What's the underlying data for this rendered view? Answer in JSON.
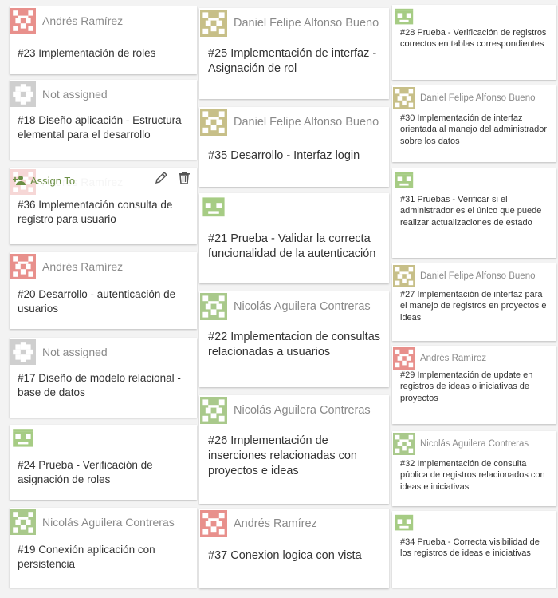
{
  "board": {
    "columns": [
      {
        "cards": [
          {
            "owner": "Andrés Ramírez",
            "avatar": "red",
            "title": "#23 Implementación de roles"
          },
          {
            "owner": "Not assigned",
            "avatar": "gray",
            "title": "#18 Diseño aplicación - Estructura elemental para el desarrollo"
          },
          {
            "owner": "Andrés Ramírez",
            "avatar": "red",
            "title": "#36 Implementación consulta de registro para usuario",
            "hovered": true
          },
          {
            "owner": "Andrés Ramírez",
            "avatar": "red",
            "title": "#20 Desarrollo - autenticación de usuarios"
          },
          {
            "owner": "Not assigned",
            "avatar": "gray",
            "title": "#17 Diseño de modelo relacional - base de datos"
          },
          {
            "owner": "",
            "avatar": "green2",
            "title": "#24 Prueba - Verificación de asignación de roles"
          },
          {
            "owner": "Nicolás Aguilera Contreras",
            "avatar": "green",
            "title": "#19 Conexión aplicación con persistencia"
          }
        ]
      },
      {
        "cards": [
          {
            "owner": "Daniel Felipe Alfonso Bueno",
            "avatar": "olive",
            "title": "#25 Implementación de interfaz - Asignación de rol"
          },
          {
            "owner": "Daniel Felipe Alfonso Bueno",
            "avatar": "olive",
            "title": "#35 Desarrollo - Interfaz login"
          },
          {
            "owner": "",
            "avatar": "green2",
            "title": "#21 Prueba - Validar la correcta funcionalidad de la autenticación"
          },
          {
            "owner": "Nicolás Aguilera Contreras",
            "avatar": "green",
            "title": "#22 Implementacion de consultas relacionadas a usuarios"
          },
          {
            "owner": "Nicolás Aguilera Contreras",
            "avatar": "green",
            "title": "#26 Implementación de inserciones relacionadas con proyectos e ideas"
          },
          {
            "owner": "Andrés Ramírez",
            "avatar": "red",
            "title": "#37 Conexion logica con vista"
          }
        ]
      },
      {
        "cards": [
          {
            "owner": "",
            "avatar": "green2",
            "title": "#28 Prueba - Verificación de registros correctos en tablas correspondientes"
          },
          {
            "owner": "Daniel Felipe Alfonso Bueno",
            "avatar": "olive",
            "title": "#30 Implementación de interfaz orientada al manejo del administrador sobre los datos"
          },
          {
            "owner": "",
            "avatar": "green2",
            "title": "#31 Pruebas - Verificar si el administrador es el único que puede realizar actualizaciones de estado"
          },
          {
            "owner": "Daniel Felipe Alfonso Bueno",
            "avatar": "olive",
            "title": "#27 Implementación de interfaz para el manejo de registros en proyectos e ideas"
          },
          {
            "owner": "Andrés Ramírez",
            "avatar": "red",
            "title": "#29 Implementación de update en registros de ideas o iniciativas de proyectos"
          },
          {
            "owner": "Nicolás Aguilera Contreras",
            "avatar": "green",
            "title": "#32 Implementación de consulta pública de registros relacionados con ideas e iniciativas"
          },
          {
            "owner": "",
            "avatar": "green2",
            "title": "#34 Prueba - Correcta visibilidad de los registros de ideas e iniciativas"
          }
        ]
      }
    ]
  },
  "hover_actions": {
    "assign_label": "Assign To",
    "assign_icon": "person-add-icon",
    "edit_icon": "pencil-icon",
    "delete_icon": "trash-icon"
  },
  "colors": {
    "red": "#e8908c",
    "gray": "#cfcfcf",
    "olive": "#c7bf88",
    "green": "#a9c98b",
    "green2": "#a6cc84",
    "accent": "#6c8f45"
  }
}
